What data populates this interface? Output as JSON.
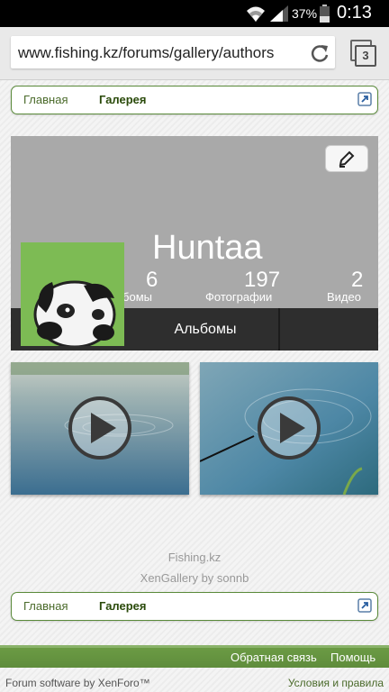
{
  "status_bar": {
    "battery_percent": "37%",
    "time": "0:13"
  },
  "browser": {
    "url": "www.fishing.kz/forums/gallery/authors",
    "tab_count": "3"
  },
  "breadcrumb": {
    "home": "Главная",
    "gallery": "Галерея"
  },
  "profile": {
    "username": "Huntaa",
    "stats": [
      {
        "value": "6",
        "label": "Альбомы"
      },
      {
        "value": "197",
        "label": "Фотографии"
      },
      {
        "value": "2",
        "label": "Видео"
      }
    ],
    "active_tab": "Альбомы"
  },
  "footer": {
    "site_name": "Fishing.kz",
    "gallery_credit": "XenGallery by sonnb",
    "feedback": "Обратная связь",
    "help": "Помощь",
    "copyright": "Forum software by XenForo™",
    "terms": "Условия и правила"
  },
  "icons": [
    "wifi-icon",
    "signal-icon",
    "battery-icon",
    "reload-icon",
    "tabs-icon",
    "jump-icon",
    "edit-icon",
    "play-icon"
  ],
  "colors": {
    "accent_green": "#5f8c3c",
    "profile_bg": "#a9a9a9",
    "tab_bar": "#2e2e2e"
  }
}
